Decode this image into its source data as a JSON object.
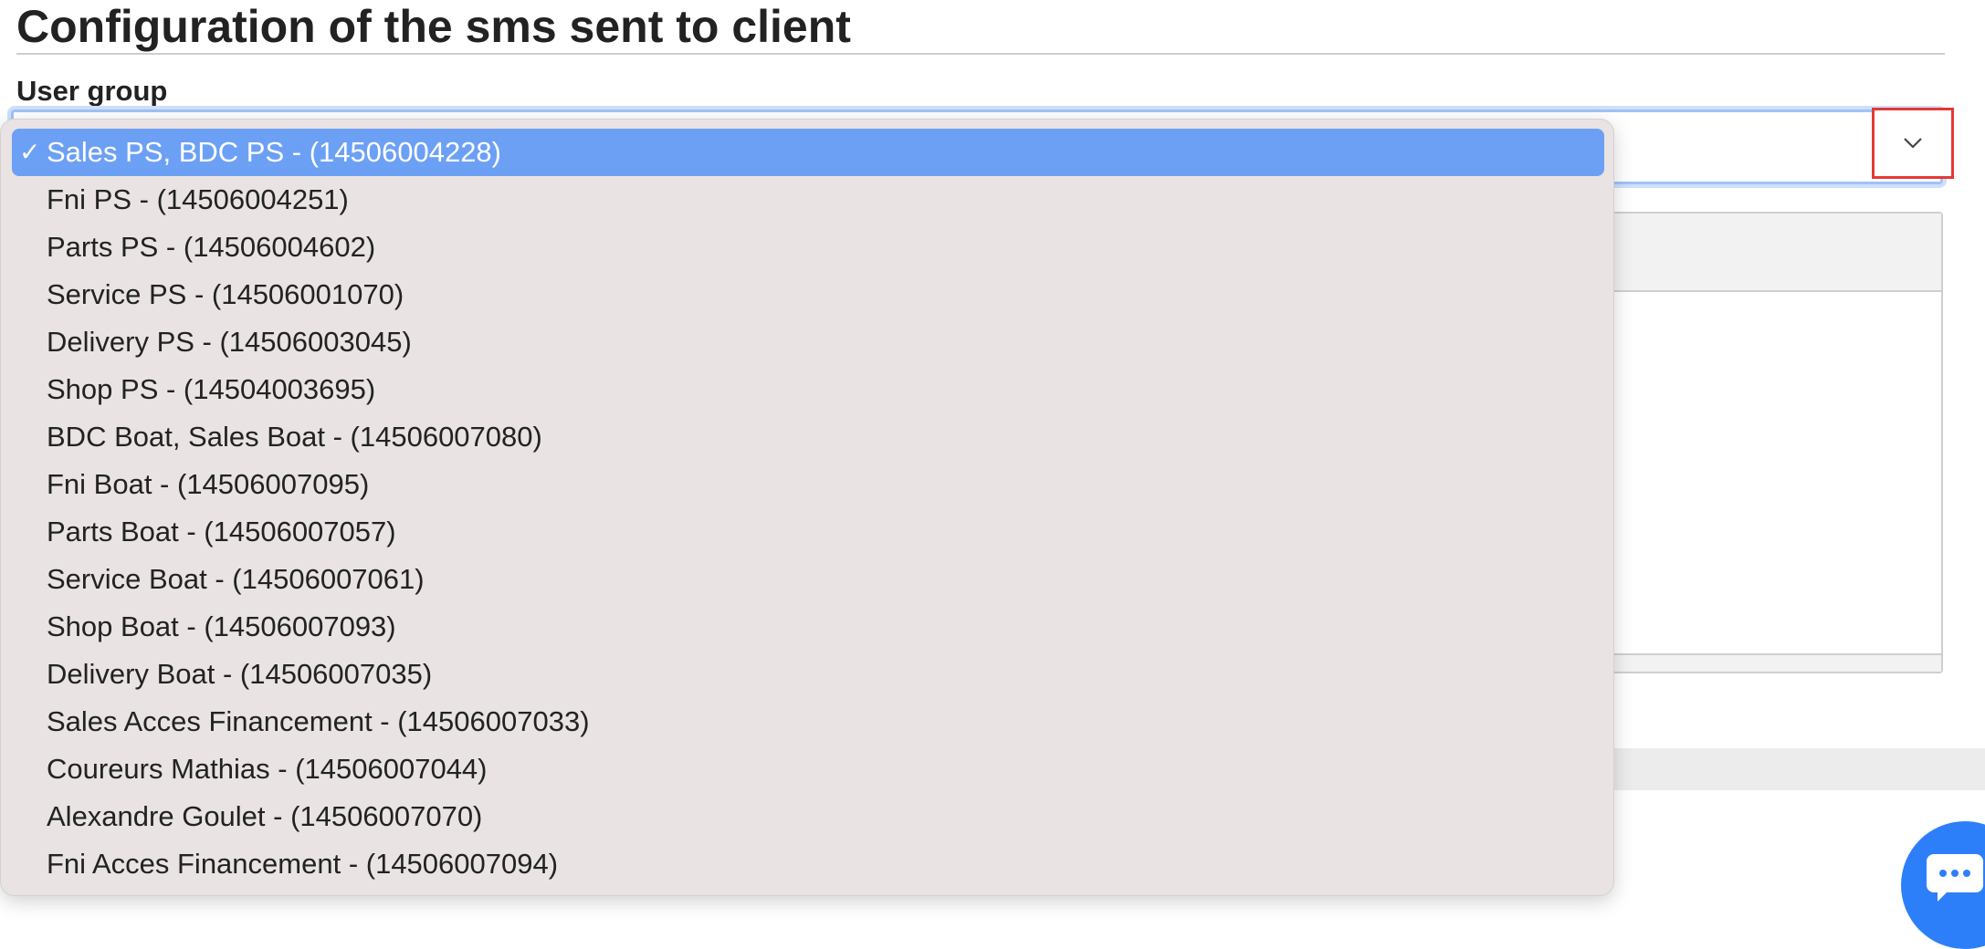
{
  "page": {
    "title": "Configuration of the sms sent to client",
    "field_label": "User group"
  },
  "select": {
    "selected_value": "Sales PS, BDC PS - (14506004228)",
    "arrow_icon": "chevron-down-icon",
    "highlight_color": "#e53935"
  },
  "dropdown": {
    "check_mark": "✓",
    "selected_color": "#6ca0f5",
    "options": [
      {
        "label": "Sales PS, BDC PS - (14506004228)"
      },
      {
        "label": "Fni PS - (14506004251)"
      },
      {
        "label": "Parts PS - (14506004602)"
      },
      {
        "label": "Service PS - (14506001070)"
      },
      {
        "label": "Delivery PS - (14506003045)"
      },
      {
        "label": "Shop PS - (14504003695)"
      },
      {
        "label": "BDC Boat, Sales Boat - (14506007080)"
      },
      {
        "label": "Fni Boat - (14506007095)"
      },
      {
        "label": "Parts Boat - (14506007057)"
      },
      {
        "label": "Service Boat - (14506007061)"
      },
      {
        "label": "Shop Boat - (14506007093)"
      },
      {
        "label": "Delivery Boat - (14506007035)"
      },
      {
        "label": "Sales Acces Financement - (14506007033)"
      },
      {
        "label": "Coureurs Mathias - (14506007044)"
      },
      {
        "label": "Alexandre Goulet - (14506007070)"
      },
      {
        "label": "Fni Acces Financement - (14506007094)"
      }
    ]
  },
  "chat": {
    "icon": "chat-icon",
    "color": "#2d7ff9"
  }
}
